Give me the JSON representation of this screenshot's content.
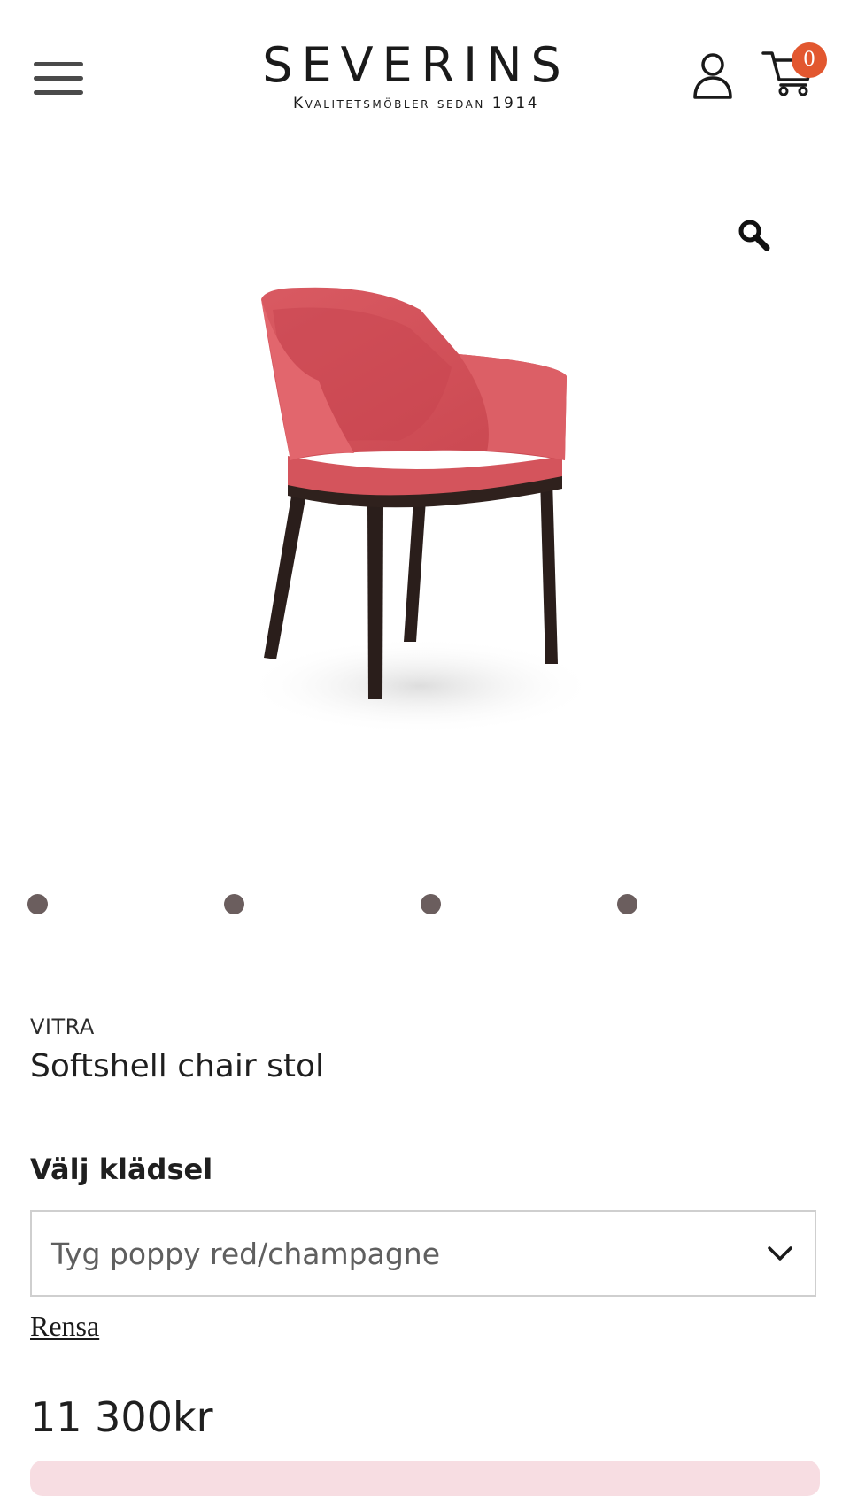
{
  "header": {
    "logo_name": "SEVERINS",
    "logo_tagline": "Kvalitetsmöbler sedan 1914",
    "cart_count": "0",
    "badge_color": "#e2572f"
  },
  "icons": {
    "menu": "hamburger-menu-icon",
    "user": "user-icon",
    "cart": "shopping-cart-icon",
    "zoom": "search-zoom-icon",
    "chevron": "chevron-down-icon"
  },
  "gallery": {
    "slide_count": 4,
    "dot_color": "#6b5e5e",
    "image": "red upholstered armchair with dark legs"
  },
  "product": {
    "brand": "VITRA",
    "title": "Softshell chair stol",
    "select_label": "Välj klädsel",
    "selected_upholstery": "Tyg poppy red/champagne",
    "clear_label": "Rensa",
    "price": "11 300kr"
  }
}
